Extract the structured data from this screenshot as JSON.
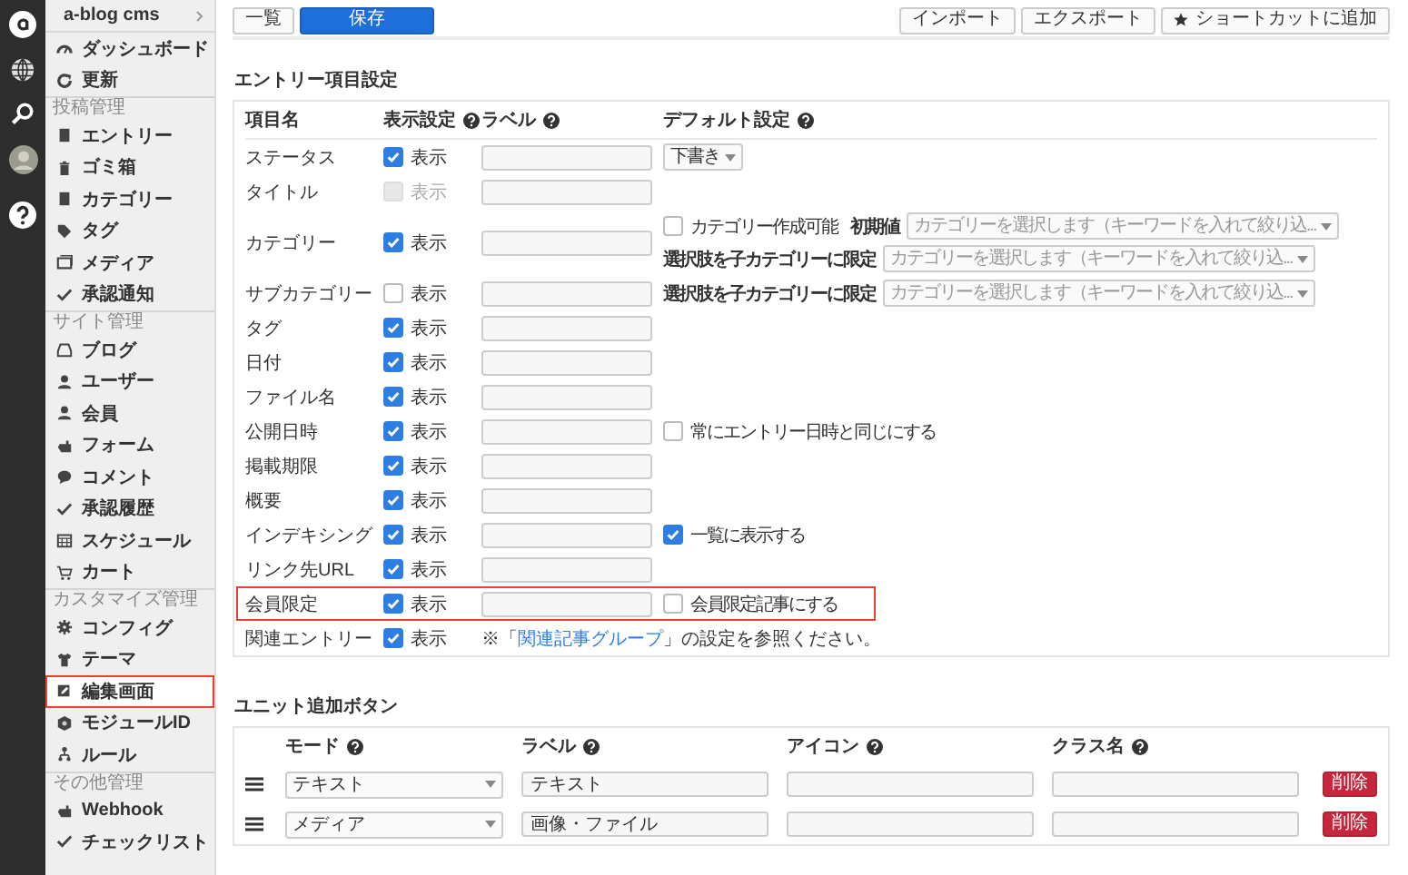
{
  "sidebar": {
    "title": "a-blog cms",
    "groups": [
      {
        "items": [
          {
            "label": "ダッシュボード",
            "selected": false,
            "highlighted": false
          },
          {
            "label": "更新",
            "selected": false,
            "highlighted": false
          }
        ]
      },
      {
        "title": "投稿管理",
        "items": [
          {
            "label": "エントリー",
            "selected": false,
            "highlighted": false
          },
          {
            "label": "ゴミ箱",
            "selected": false,
            "highlighted": false
          },
          {
            "label": "カテゴリー",
            "selected": false,
            "highlighted": false
          },
          {
            "label": "タグ",
            "selected": false,
            "highlighted": false
          },
          {
            "label": "メディア",
            "selected": false,
            "highlighted": false
          },
          {
            "label": "承認通知",
            "selected": false,
            "highlighted": false
          }
        ]
      },
      {
        "title": "サイト管理",
        "items": [
          {
            "label": "ブログ",
            "selected": false,
            "highlighted": false
          },
          {
            "label": "ユーザー",
            "selected": false,
            "highlighted": false
          },
          {
            "label": "会員",
            "selected": false,
            "highlighted": false
          },
          {
            "label": "フォーム",
            "selected": false,
            "highlighted": false
          },
          {
            "label": "コメント",
            "selected": false,
            "highlighted": false
          },
          {
            "label": "承認履歴",
            "selected": false,
            "highlighted": false
          },
          {
            "label": "スケジュール",
            "selected": false,
            "highlighted": false
          },
          {
            "label": "カート",
            "selected": false,
            "highlighted": false
          }
        ]
      },
      {
        "title": "カスタマイズ管理",
        "items": [
          {
            "label": "コンフィグ",
            "selected": false,
            "highlighted": false
          },
          {
            "label": "テーマ",
            "selected": false,
            "highlighted": false
          },
          {
            "label": "編集画面",
            "selected": true,
            "highlighted": true
          },
          {
            "label": "モジュールID",
            "selected": false,
            "highlighted": false
          },
          {
            "label": "ルール",
            "selected": false,
            "highlighted": false
          }
        ]
      },
      {
        "title": "その他管理",
        "items": [
          {
            "label": "Webhook",
            "selected": false,
            "highlighted": false
          },
          {
            "label": "チェックリスト",
            "selected": false,
            "highlighted": false
          }
        ]
      }
    ]
  },
  "toolbar": {
    "left": [
      {
        "label": "一覧",
        "kind": "plain"
      },
      {
        "label": "保存",
        "kind": "primary"
      }
    ],
    "right": [
      {
        "label": "インポート",
        "kind": "plain"
      },
      {
        "label": "エクスポート",
        "kind": "plain"
      },
      {
        "label": "ショートカットに追加",
        "kind": "shortcut"
      }
    ]
  },
  "entry_settings": {
    "title": "エントリー項目設定",
    "columns": [
      {
        "label": "項目名",
        "help": false
      },
      {
        "label": "表示設定",
        "help": true
      },
      {
        "label": "ラベル",
        "help": true
      },
      {
        "label": "デフォルト設定",
        "help": true
      }
    ],
    "rows": [
      {
        "name": "ステータス",
        "checked": true,
        "disabled": false,
        "display_label": "表示",
        "highlighted": false,
        "label_cell": {
          "kind": "input"
        },
        "default": {
          "kind": "select",
          "value": "下書き"
        }
      },
      {
        "name": "タイトル",
        "checked": false,
        "disabled": true,
        "display_label": "表示",
        "highlighted": false,
        "label_cell": {
          "kind": "input"
        }
      },
      {
        "name": "カテゴリー",
        "checked": true,
        "disabled": false,
        "display_label": "表示",
        "highlighted": false,
        "label_cell": {
          "kind": "input"
        },
        "default": {
          "kind": "category",
          "checkbox_label": "カテゴリー作成可能",
          "checked": false,
          "initial_label": "初期値",
          "initial_placeholder": "カテゴリーを選択します（キーワードを入れて絞り込...",
          "limit_label": "選択肢を子カテゴリーに限定",
          "limit_placeholder": "カテゴリーを選択します（キーワードを入れて絞り込..."
        }
      },
      {
        "name": "サブカテゴリー",
        "checked": false,
        "disabled": false,
        "display_label": "表示",
        "highlighted": false,
        "label_cell": {
          "kind": "input"
        },
        "default": {
          "kind": "limit",
          "label": "選択肢を子カテゴリーに限定",
          "placeholder": "カテゴリーを選択します（キーワードを入れて絞り込..."
        }
      },
      {
        "name": "タグ",
        "checked": true,
        "disabled": false,
        "display_label": "表示",
        "highlighted": false,
        "label_cell": {
          "kind": "input"
        }
      },
      {
        "name": "日付",
        "checked": true,
        "disabled": false,
        "display_label": "表示",
        "highlighted": false,
        "label_cell": {
          "kind": "input"
        }
      },
      {
        "name": "ファイル名",
        "checked": true,
        "disabled": false,
        "display_label": "表示",
        "highlighted": false,
        "label_cell": {
          "kind": "input"
        }
      },
      {
        "name": "公開日時",
        "checked": true,
        "disabled": false,
        "display_label": "表示",
        "highlighted": false,
        "label_cell": {
          "kind": "input"
        },
        "default": {
          "kind": "checkbox",
          "label": "常にエントリー日時と同じにする",
          "checked": false
        }
      },
      {
        "name": "掲載期限",
        "checked": true,
        "disabled": false,
        "display_label": "表示",
        "highlighted": false,
        "label_cell": {
          "kind": "input"
        }
      },
      {
        "name": "概要",
        "checked": true,
        "disabled": false,
        "display_label": "表示",
        "highlighted": false,
        "label_cell": {
          "kind": "input"
        }
      },
      {
        "name": "インデキシング",
        "checked": true,
        "disabled": false,
        "display_label": "表示",
        "highlighted": false,
        "label_cell": {
          "kind": "input"
        },
        "default": {
          "kind": "checkbox",
          "label": "一覧に表示する",
          "checked": true
        }
      },
      {
        "name": "リンク先URL",
        "checked": true,
        "disabled": false,
        "display_label": "表示",
        "highlighted": false,
        "label_cell": {
          "kind": "input"
        }
      },
      {
        "name": "会員限定",
        "checked": true,
        "disabled": false,
        "display_label": "表示",
        "highlighted": true,
        "label_cell": {
          "kind": "input"
        },
        "default": {
          "kind": "checkbox",
          "label": "会員限定記事にする",
          "checked": false
        }
      },
      {
        "name": "関連エントリー",
        "checked": true,
        "disabled": false,
        "display_label": "表示",
        "highlighted": false,
        "label_cell": {
          "kind": "note",
          "before": "※「",
          "link": "関連記事グループ",
          "after": "」の設定を参照ください。"
        }
      }
    ]
  },
  "unit_buttons": {
    "title": "ユニット追加ボタン",
    "columns": [
      {
        "label": "モード",
        "help": true
      },
      {
        "label": "ラベル",
        "help": true
      },
      {
        "label": "アイコン",
        "help": true
      },
      {
        "label": "クラス名",
        "help": true
      }
    ],
    "rows": [
      {
        "mode": "テキスト",
        "label": "テキスト",
        "delete": "削除"
      },
      {
        "mode": "メディア",
        "label": "画像・ファイル",
        "delete": "削除"
      }
    ]
  }
}
